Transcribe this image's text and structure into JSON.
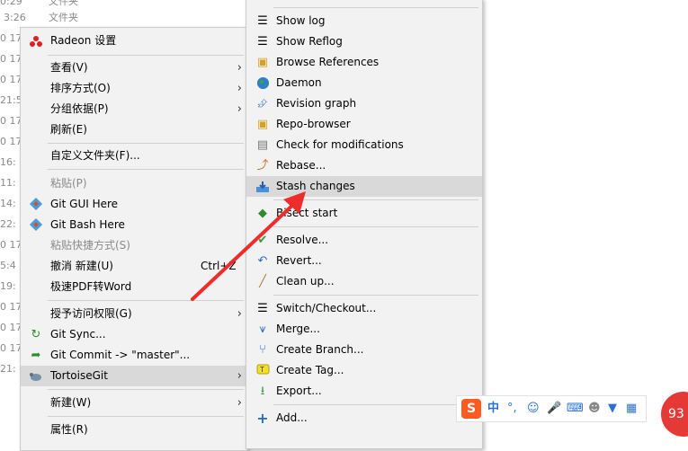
{
  "background_rows": [
    {
      "time": "0:29",
      "name": "文件夹"
    },
    {
      "time": "3:26",
      "name": "文件夹"
    },
    {
      "time": "0 17",
      "name": ""
    },
    {
      "time": "0 17",
      "name": ""
    },
    {
      "time": "0 17",
      "name": ""
    },
    {
      "time": "21:5",
      "name": ""
    },
    {
      "time": "0 17",
      "name": ""
    },
    {
      "time": "0 17",
      "name": ""
    },
    {
      "time": "16:",
      "name": ""
    },
    {
      "time": "11:",
      "name": ""
    },
    {
      "time": "14:",
      "name": ""
    },
    {
      "time": "22:",
      "name": ""
    },
    {
      "time": "0 17",
      "name": ""
    },
    {
      "time": "5:4",
      "name": ""
    },
    {
      "time": "19:",
      "name": ""
    },
    {
      "time": "0 17",
      "name": ""
    },
    {
      "time": "0 17",
      "name": ""
    },
    {
      "time": "0 17",
      "name": ""
    },
    {
      "time": "21:",
      "name": ""
    }
  ],
  "context_menu": {
    "radeon": "Radeon 设置",
    "view": "查看(V)",
    "sort": "排序方式(O)",
    "group": "分组依据(P)",
    "refresh": "刷新(E)",
    "customize": "自定义文件夹(F)...",
    "paste": "粘贴(P)",
    "git_gui": "Git GUI Here",
    "git_bash": "Git Bash Here",
    "paste_shortcut": "粘贴快捷方式(S)",
    "undo_new": "撤消 新建(U)",
    "undo_shortcut": "Ctrl+Z",
    "pdf": "极速PDF转Word",
    "grant_access": "授予访问权限(G)",
    "git_sync": "Git Sync...",
    "git_commit": "Git Commit -> \"master\"...",
    "tortoisegit": "TortoiseGit",
    "new": "新建(W)",
    "properties": "属性(R)"
  },
  "tortoisegit_menu": {
    "show_log": "Show log",
    "show_reflog": "Show Reflog",
    "browse_refs": "Browse References",
    "daemon": "Daemon",
    "revision_graph": "Revision graph",
    "repo_browser": "Repo-browser",
    "check_mods": "Check for modifications",
    "rebase": "Rebase...",
    "stash": "Stash changes",
    "bisect": "Bisect start",
    "resolve": "Resolve...",
    "revert": "Revert...",
    "cleanup": "Clean up...",
    "switch": "Switch/Checkout...",
    "merge": "Merge...",
    "create_branch": "Create Branch...",
    "create_tag": "Create Tag...",
    "export": "Export...",
    "add": "Add..."
  },
  "ime_toolbar": {
    "logo": "S",
    "mode": "中",
    "punct": "°,"
  },
  "badge": "93"
}
